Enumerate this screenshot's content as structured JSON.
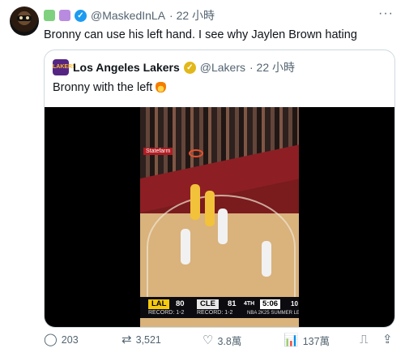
{
  "tweet": {
    "display_name": "@MaskedInLA",
    "time_label": "· 22 小時",
    "text": "Bronny can use his left hand. I see why Jaylen Brown hating",
    "more_glyph": "···"
  },
  "quote": {
    "name": "Los Angeles Lakers",
    "handle": "@Lakers",
    "time_label": "· 22 小時",
    "text": "Bronny with the left",
    "logo_text": "LAKERS"
  },
  "scoreboard": {
    "team1": "LAL",
    "score1": "80",
    "team2": "CLE",
    "score2": "81",
    "period": "4TH",
    "clock": "5:06",
    "shot_clock": "10",
    "record1": "RECORD: 1-2",
    "record2": "RECORD: 1-2",
    "league": "NBA 2K25 SUMMER LEAGUE",
    "banner": "Statefarm"
  },
  "actions": {
    "replies": "203",
    "reposts": "3,521",
    "likes": "3.8萬",
    "views": "137萬"
  },
  "colors": {
    "verified_blue": "#1d9bf0",
    "lakers_purple": "#552583",
    "lakers_gold": "#fdb927"
  }
}
